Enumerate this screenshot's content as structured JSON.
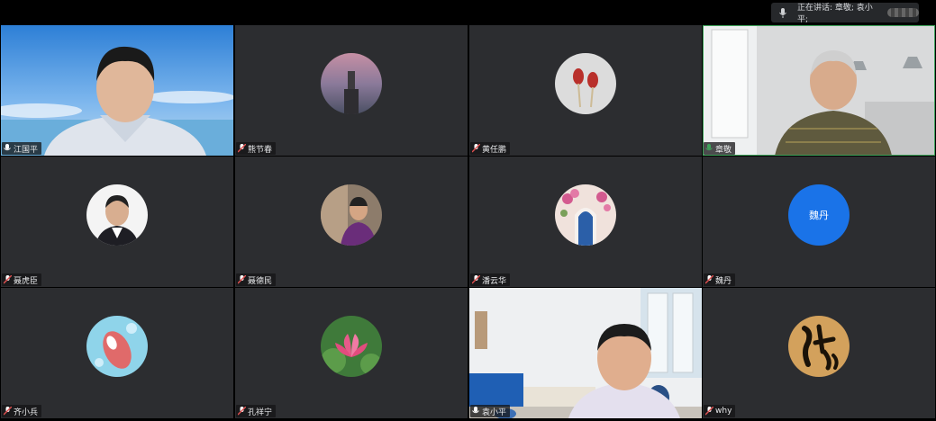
{
  "status_bar": {
    "speaking_label": "正在讲话: 章敬; 袁小平;"
  },
  "participants": [
    {
      "name": "江国平",
      "type": "video",
      "muted": false
    },
    {
      "name": "熊节春",
      "type": "avatar",
      "muted": true
    },
    {
      "name": "黄任鹏",
      "type": "avatar",
      "muted": true
    },
    {
      "name": "章敬",
      "type": "video",
      "muted": false,
      "active": true
    },
    {
      "name": "聂虎臣",
      "type": "avatar",
      "muted": true
    },
    {
      "name": "聂德民",
      "type": "avatar",
      "muted": true
    },
    {
      "name": "潘云华",
      "type": "avatar",
      "muted": true
    },
    {
      "name": "魏丹",
      "type": "avatar",
      "muted": true,
      "avatar_text": "魏丹"
    },
    {
      "name": "齐小兵",
      "type": "avatar",
      "muted": true
    },
    {
      "name": "孔祥宁",
      "type": "avatar",
      "muted": true
    },
    {
      "name": "袁小平",
      "type": "video",
      "muted": false
    },
    {
      "name": "why",
      "type": "avatar",
      "muted": true
    }
  ],
  "colors": {
    "tile_bg": "#2c2d30",
    "active_border": "#3ea35a",
    "avatar_blue": "#1a73e8"
  }
}
